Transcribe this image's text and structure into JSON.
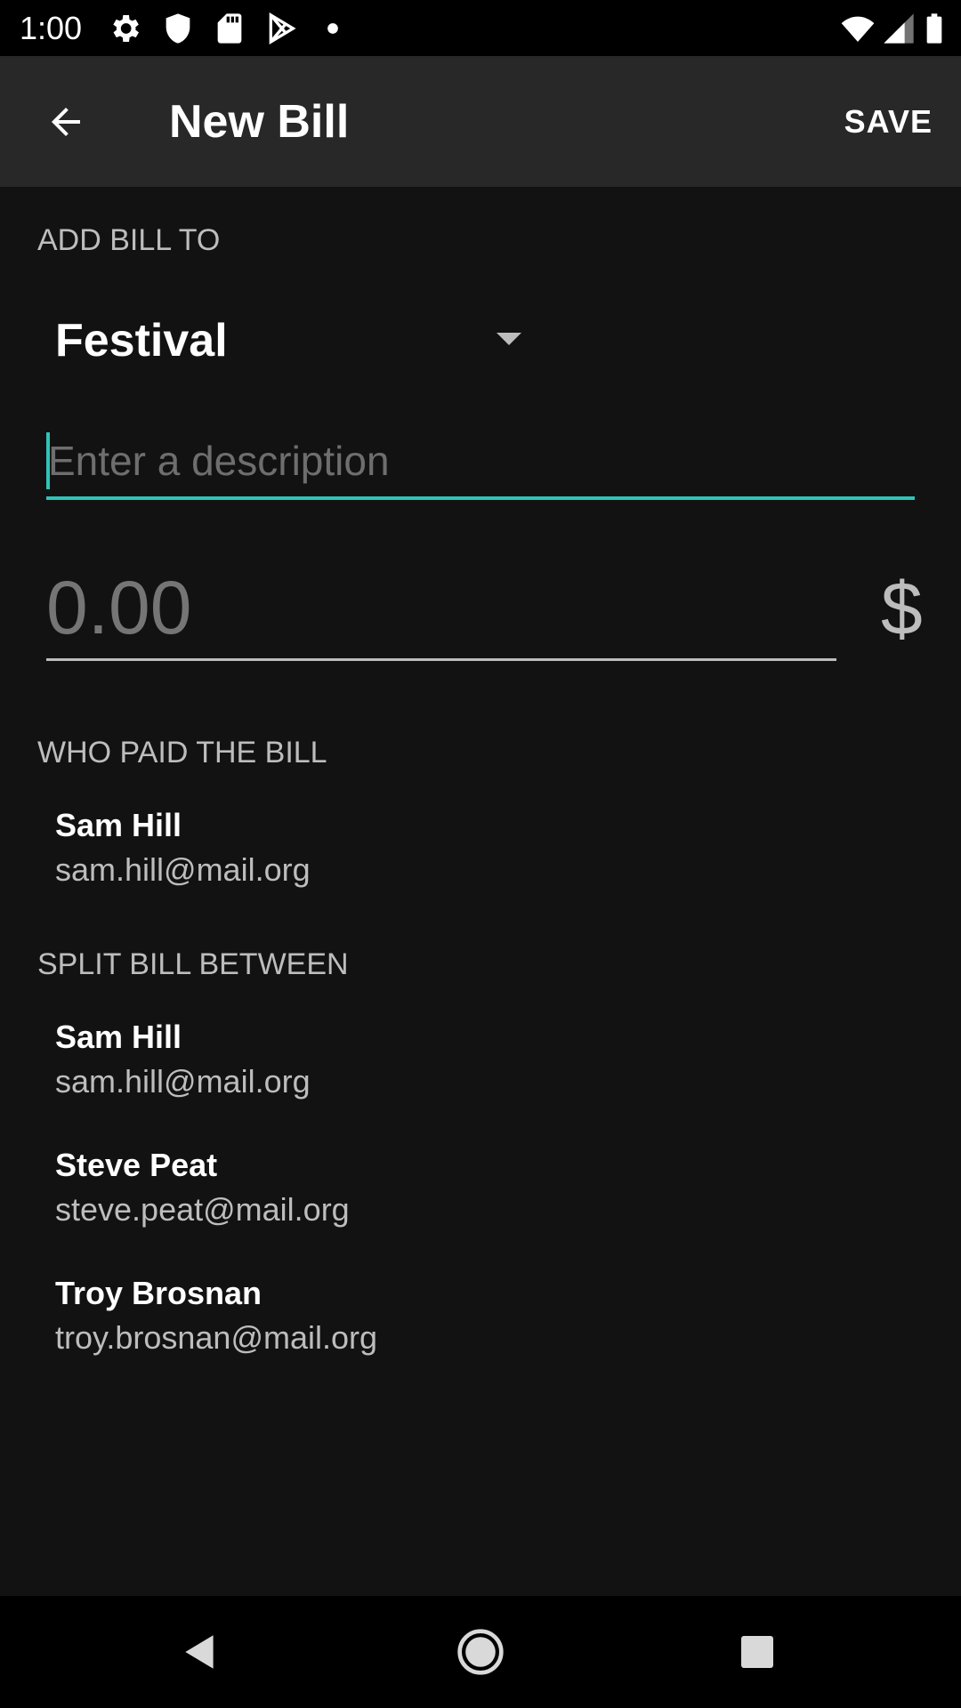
{
  "status_bar": {
    "time": "1:00",
    "icons": [
      "gear-icon",
      "shield-icon",
      "sd-card-icon",
      "play-store-icon",
      "dot-icon",
      "wifi-icon",
      "signal-icon",
      "battery-icon"
    ]
  },
  "app_bar": {
    "title": "New Bill",
    "save_label": "SAVE",
    "back_icon": "arrow-left-icon"
  },
  "add_bill_to": {
    "header": "ADD BILL TO",
    "selected_group": "Festival"
  },
  "description": {
    "value": "",
    "placeholder": "Enter a description"
  },
  "amount": {
    "value": "",
    "placeholder": "0.00",
    "currency_symbol": "$"
  },
  "who_paid": {
    "header": "WHO PAID THE BILL",
    "person": {
      "name": "Sam Hill",
      "email": "sam.hill@mail.org"
    }
  },
  "split_between": {
    "header": "SPLIT BILL BETWEEN",
    "people": [
      {
        "name": "Sam Hill",
        "email": "sam.hill@mail.org"
      },
      {
        "name": "Steve Peat",
        "email": "steve.peat@mail.org"
      },
      {
        "name": "Troy Brosnan",
        "email": "troy.brosnan@mail.org"
      }
    ]
  },
  "colors": {
    "accent": "#2ec4b6",
    "background": "#121212",
    "app_bar": "#282828",
    "secondary_text": "#bdbdbd"
  },
  "nav_bar": {
    "icons": [
      "back-triangle-icon",
      "home-circle-icon",
      "recents-square-icon"
    ]
  }
}
